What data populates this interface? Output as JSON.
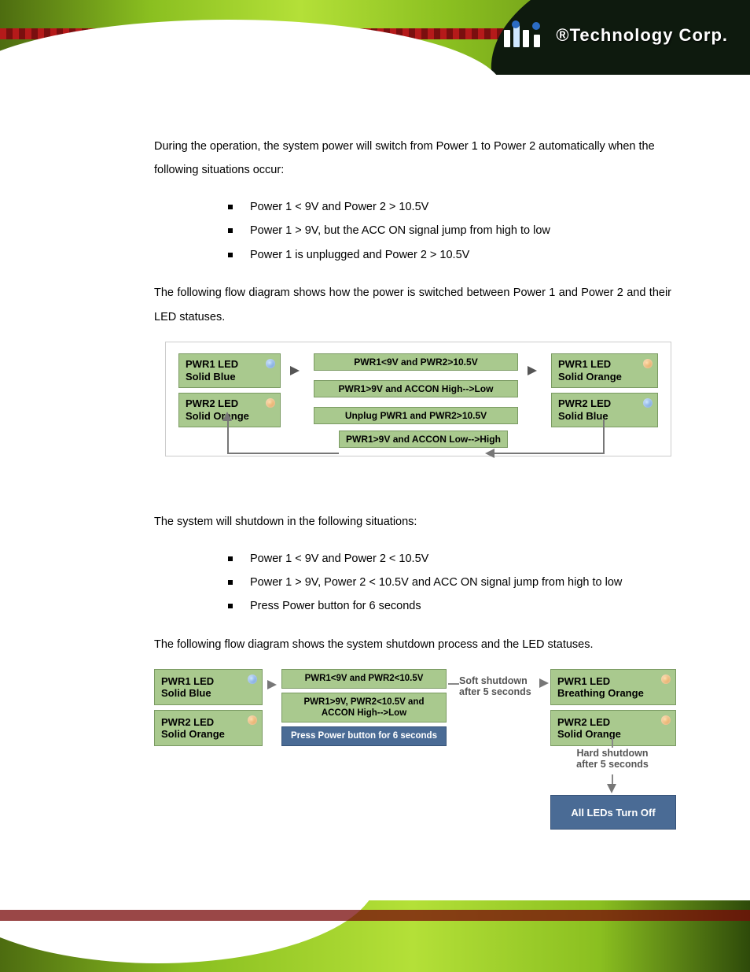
{
  "brand": {
    "reg": "®",
    "name": "Technology Corp."
  },
  "section1": {
    "intro": "During the operation, the system power will switch from Power 1 to Power 2 automatically when the following situations occur:",
    "bullets": [
      "Power 1 < 9V and Power 2 > 10.5V",
      "Power 1 > 9V, but the ACC ON signal jump from high to low",
      "Power 1 is unplugged and Power 2 > 10.5V"
    ],
    "after": "The following flow diagram shows how the power is switched between Power 1 and Power 2 and their LED statuses."
  },
  "diagram1": {
    "left": {
      "pwr1": {
        "l1": "PWR1 LED",
        "l2": "Solid Blue",
        "dot": "blue"
      },
      "pwr2": {
        "l1": "PWR2 LED",
        "l2": "Solid Orange",
        "dot": "orange"
      }
    },
    "center": [
      "PWR1<9V and PWR2>10.5V",
      "PWR1>9V and ACCON High-->Low",
      "Unplug PWR1 and PWR2>10.5V"
    ],
    "right": {
      "pwr1": {
        "l1": "PWR1 LED",
        "l2": "Solid Orange",
        "dot": "orange"
      },
      "pwr2": {
        "l1": "PWR2 LED",
        "l2": "Solid Blue",
        "dot": "blue"
      }
    },
    "bottom": "PWR1>9V and ACCON Low-->High"
  },
  "section2": {
    "intro": "The system will shutdown in the following situations:",
    "bullets": [
      "Power 1 < 9V and Power 2 < 10.5V",
      "Power 1 > 9V, Power 2 < 10.5V and ACC ON signal jump from high to low",
      "Press Power button for 6 seconds"
    ],
    "after": "The following flow diagram shows the system shutdown process and the LED statuses."
  },
  "diagram2": {
    "left": {
      "pwr1": {
        "l1": "PWR1 LED",
        "l2": "Solid Blue",
        "dot": "blue"
      },
      "pwr2": {
        "l1": "PWR2 LED",
        "l2": "Solid Orange",
        "dot": "orange"
      }
    },
    "center": [
      "PWR1<9V and PWR2<10.5V",
      "PWR1>9V, PWR2<10.5V and ACCON High-->Low",
      "Press Power button  for 6 seconds"
    ],
    "soft": {
      "l1": "Soft shutdown",
      "l2": "after 5 seconds"
    },
    "right": {
      "pwr1": {
        "l1": "PWR1 LED",
        "l2": "Breathing Orange",
        "dot": "orange"
      },
      "pwr2": {
        "l1": "PWR2 LED",
        "l2": "Solid Orange",
        "dot": "orange"
      }
    },
    "hard": {
      "l1": "Hard shutdown",
      "l2": "after 5 seconds"
    },
    "off": "All LEDs Turn Off"
  }
}
